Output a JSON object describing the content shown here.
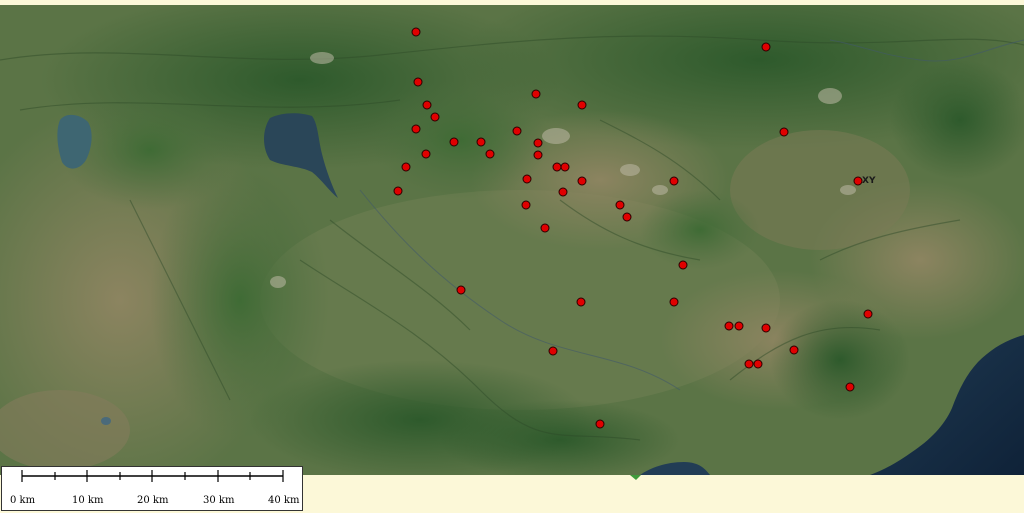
{
  "map": {
    "type": "satellite-basemap",
    "background_color": "#fcf8d8",
    "marker_color": "#e00000",
    "marker_count": 52,
    "place_label": "XY"
  },
  "scale_bar": {
    "labels": [
      "0 km",
      "10 km",
      "20 km",
      "30 km",
      "40 km"
    ]
  }
}
